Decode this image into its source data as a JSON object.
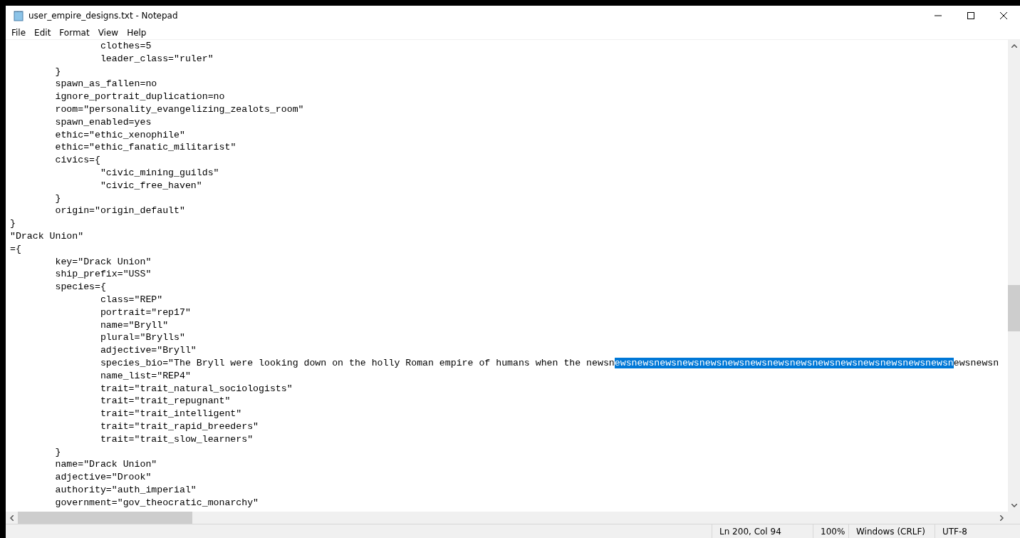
{
  "window": {
    "title": "user_empire_designs.txt - Notepad"
  },
  "menu": [
    "File",
    "Edit",
    "Format",
    "View",
    "Help"
  ],
  "editor": {
    "lines": [
      {
        "kind": "plain",
        "text": "\t\tclothes=5"
      },
      {
        "kind": "plain",
        "text": "\t\tleader_class=\"ruler\""
      },
      {
        "kind": "plain",
        "text": "\t}"
      },
      {
        "kind": "plain",
        "text": "\tspawn_as_fallen=no"
      },
      {
        "kind": "plain",
        "text": "\tignore_portrait_duplication=no"
      },
      {
        "kind": "plain",
        "text": "\troom=\"personality_evangelizing_zealots_room\""
      },
      {
        "kind": "plain",
        "text": "\tspawn_enabled=yes"
      },
      {
        "kind": "plain",
        "text": "\tethic=\"ethic_xenophile\""
      },
      {
        "kind": "plain",
        "text": "\tethic=\"ethic_fanatic_militarist\""
      },
      {
        "kind": "plain",
        "text": "\tcivics={"
      },
      {
        "kind": "plain",
        "text": "\t\t\"civic_mining_guilds\""
      },
      {
        "kind": "plain",
        "text": "\t\t\"civic_free_haven\""
      },
      {
        "kind": "plain",
        "text": "\t}"
      },
      {
        "kind": "plain",
        "text": "\torigin=\"origin_default\""
      },
      {
        "kind": "plain",
        "text": "}"
      },
      {
        "kind": "plain",
        "text": "\"Drack Union\""
      },
      {
        "kind": "plain",
        "text": "={"
      },
      {
        "kind": "plain",
        "text": "\tkey=\"Drack Union\""
      },
      {
        "kind": "plain",
        "text": "\tship_prefix=\"USS\""
      },
      {
        "kind": "plain",
        "text": "\tspecies={"
      },
      {
        "kind": "plain",
        "text": "\t\tclass=\"REP\""
      },
      {
        "kind": "plain",
        "text": "\t\tportrait=\"rep17\""
      },
      {
        "kind": "plain",
        "text": "\t\tname=\"Bryll\""
      },
      {
        "kind": "plain",
        "text": "\t\tplural=\"Brylls\""
      },
      {
        "kind": "plain",
        "text": "\t\tadjective=\"Bryll\""
      },
      {
        "kind": "selection",
        "before": "\t\tspecies_bio=\"The Bryll were looking down on the holly Roman empire of humans when the newsn",
        "selection": "ewsnewsnewsnewsnewsnewsnewsnewsnewsnewsnewsnewsnewsnewsnewsn",
        "after": "ewsnewsn"
      },
      {
        "kind": "plain",
        "text": "\t\tname_list=\"REP4\""
      },
      {
        "kind": "plain",
        "text": "\t\ttrait=\"trait_natural_sociologists\""
      },
      {
        "kind": "plain",
        "text": "\t\ttrait=\"trait_repugnant\""
      },
      {
        "kind": "plain",
        "text": "\t\ttrait=\"trait_intelligent\""
      },
      {
        "kind": "plain",
        "text": "\t\ttrait=\"trait_rapid_breeders\""
      },
      {
        "kind": "plain",
        "text": "\t\ttrait=\"trait_slow_learners\""
      },
      {
        "kind": "plain",
        "text": "\t}"
      },
      {
        "kind": "plain",
        "text": "\tname=\"Drack Union\""
      },
      {
        "kind": "plain",
        "text": "\tadjective=\"Drook\""
      },
      {
        "kind": "plain",
        "text": "\tauthority=\"auth_imperial\""
      },
      {
        "kind": "plain",
        "text": "\tgovernment=\"gov_theocratic_monarchy\""
      }
    ]
  },
  "status_bar": [
    "Ln 200, Col 94",
    "100%",
    "Windows (CRLF)",
    "UTF-8"
  ]
}
